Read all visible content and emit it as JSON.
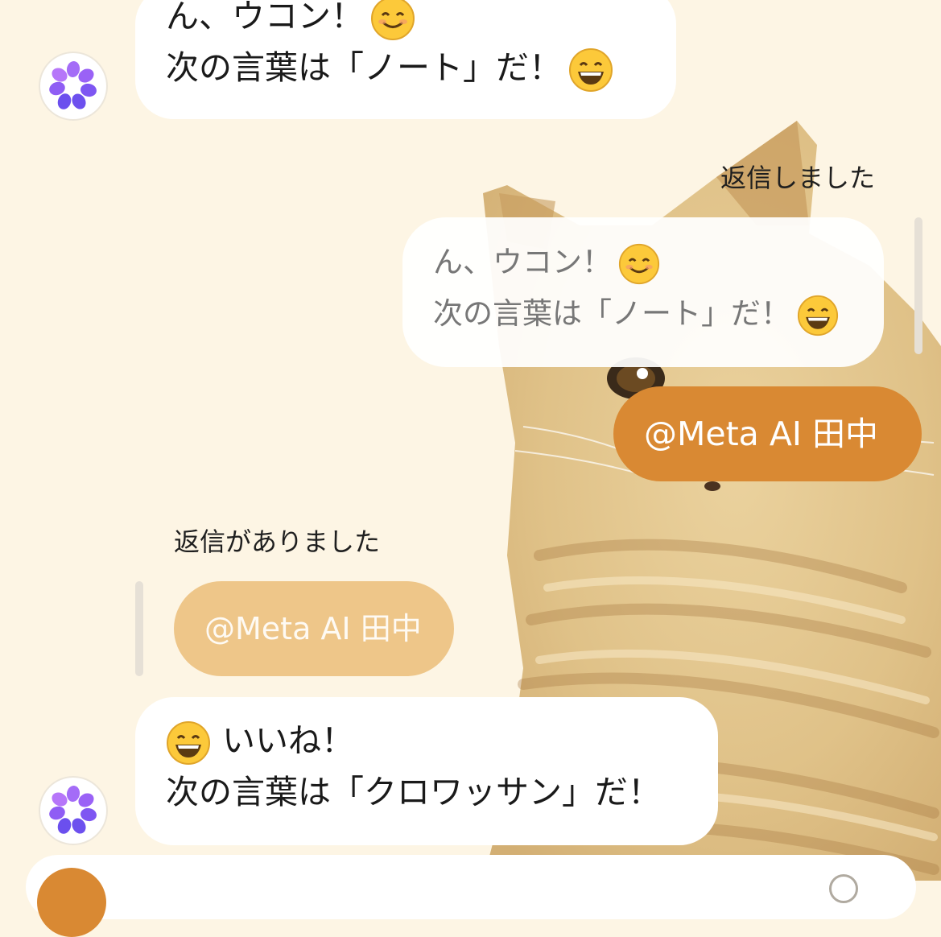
{
  "messages": [
    {
      "id": "m1",
      "type": "incoming",
      "line1_text": "ん、ウコン！",
      "line1_emoji": "smiling-face-icon",
      "line2_text": "次の言葉は「ノート」だ！",
      "line2_emoji": "grinning-face-icon"
    },
    {
      "id": "m2",
      "type": "reply-outgoing",
      "label": "返信しました",
      "quoted_line1_text": "ん、ウコン！",
      "quoted_line2_text": "次の言葉は「ノート」だ！",
      "text": "@Meta AI 田中"
    },
    {
      "id": "m3",
      "type": "reply-incoming",
      "label": "返信がありました",
      "quoted_text": "@Meta AI 田中",
      "line1_text": "いいね！",
      "line1_emoji": "grinning-face-icon",
      "line2_text": "次の言葉は「クロワッサン」だ！"
    }
  ],
  "colors": {
    "background": "#fdf5e4",
    "outgoing_bubble": "#d98933",
    "quoted_outgoing_bubble": "#eec689",
    "incoming_bubble": "#ffffff"
  },
  "icons": {
    "bot_avatar": "meta-ai-avatar-icon",
    "background_image": "cat-illustration"
  }
}
